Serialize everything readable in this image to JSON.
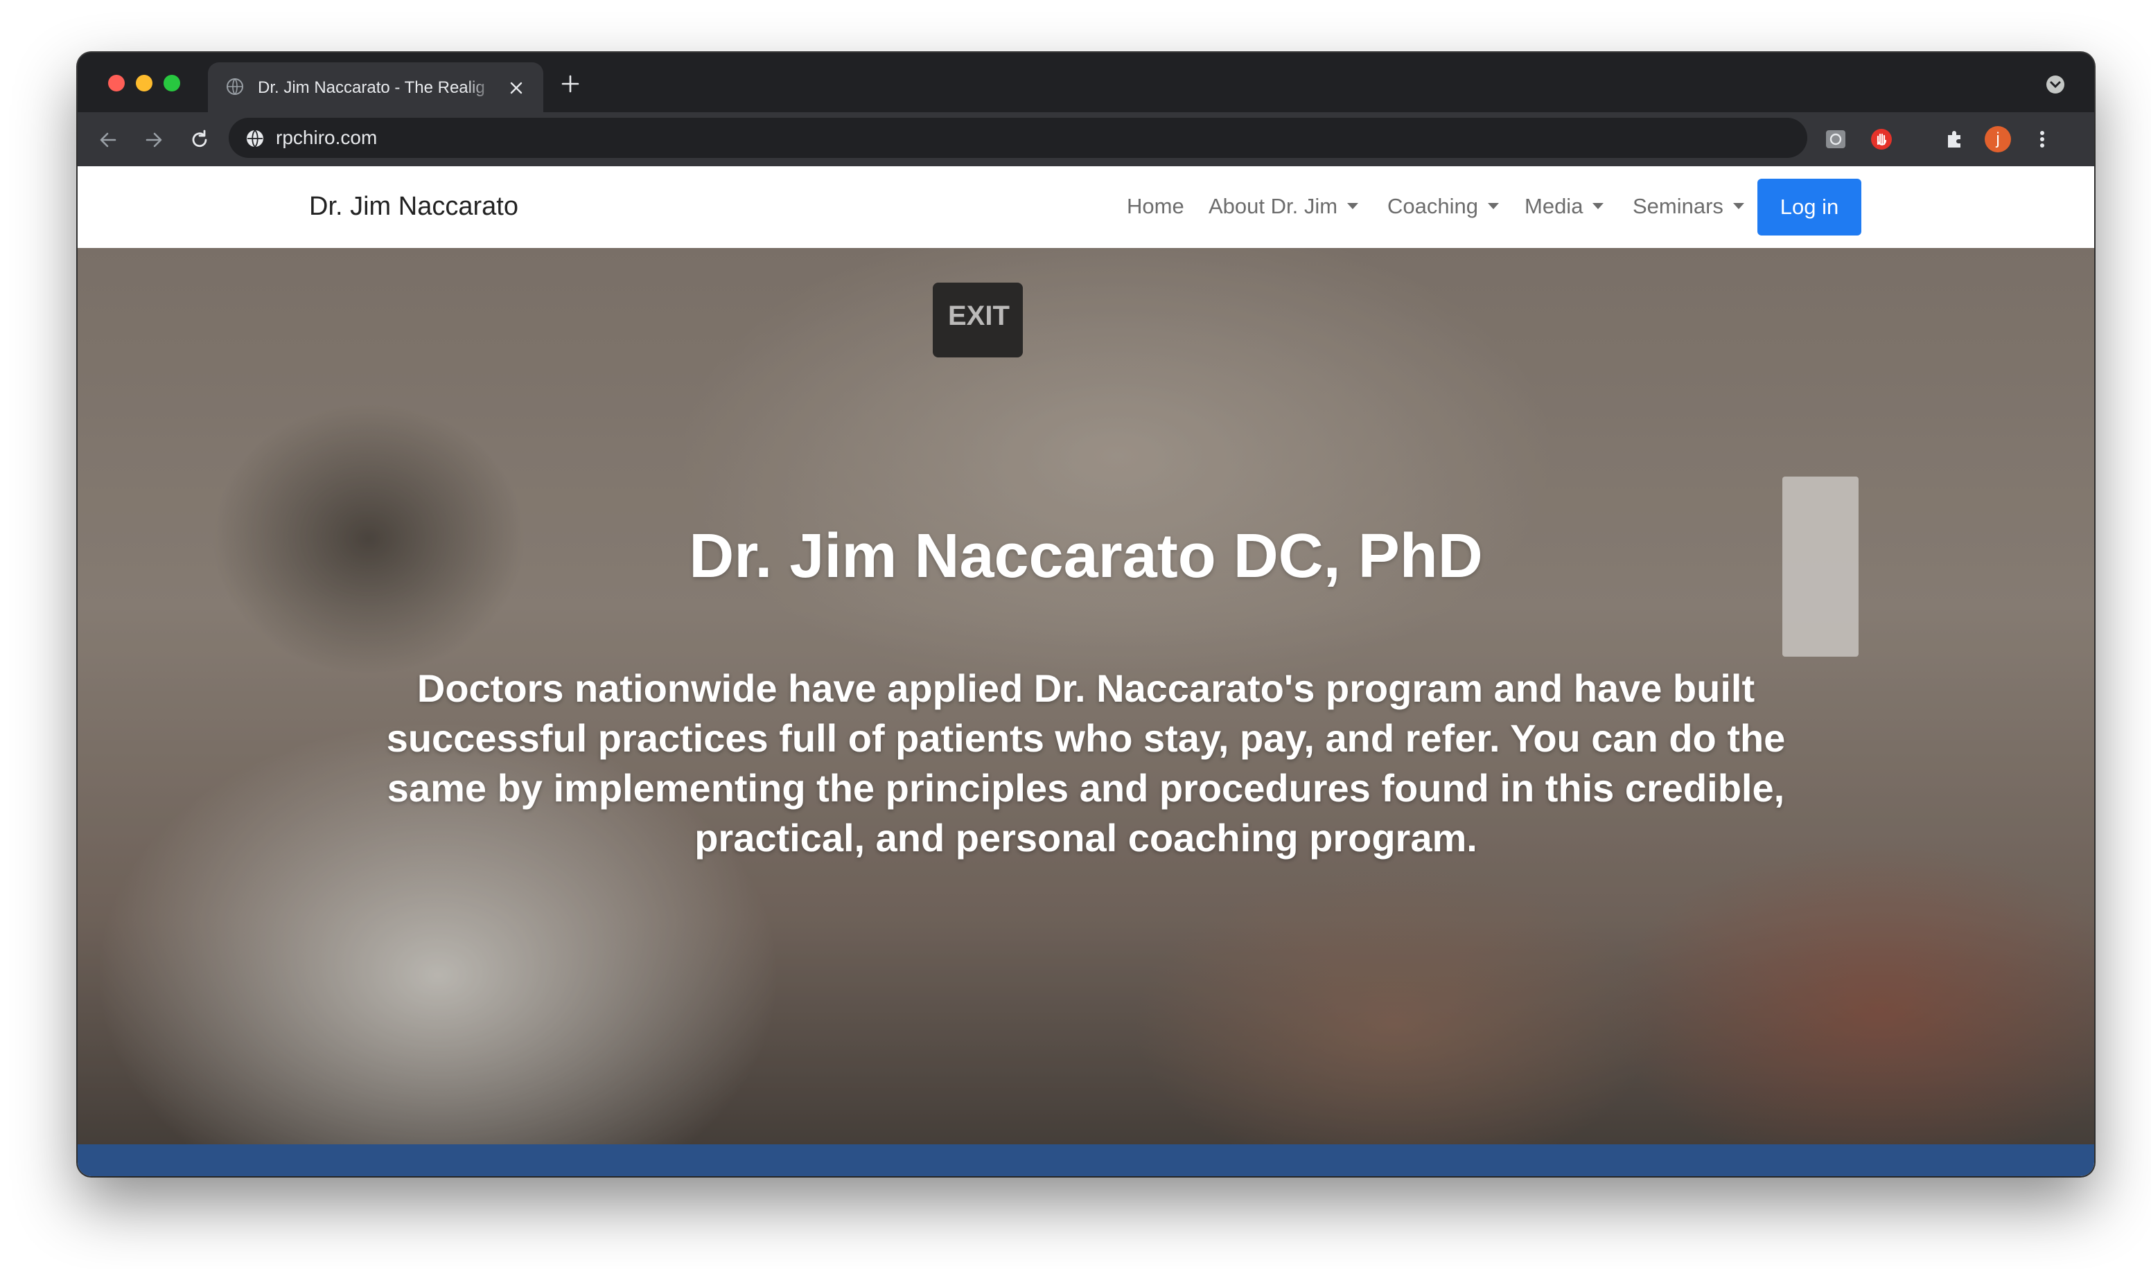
{
  "browser": {
    "tab_title": "Dr. Jim Naccarato - The Realig",
    "url": "rpchiro.com",
    "profile_initial": "j"
  },
  "site": {
    "brand": "Dr. Jim Naccarato",
    "nav": [
      {
        "label": "Home",
        "dropdown": false
      },
      {
        "label": "About Dr. Jim",
        "dropdown": true
      },
      {
        "label": "Coaching",
        "dropdown": true
      },
      {
        "label": "Media",
        "dropdown": true
      },
      {
        "label": "Seminars",
        "dropdown": true
      }
    ],
    "login_label": "Log in",
    "accent_color": "#1f7bf2"
  },
  "hero": {
    "title": "Dr. Jim Naccarato DC, PhD",
    "text": "Doctors nationwide have applied Dr. Naccarato's program and have built successful practices full of patients who stay, pay, and refer. You can do the same by implementing the principles and procedures found in this credible, practical, and personal coaching program.",
    "exit_sign": "EXIT"
  }
}
